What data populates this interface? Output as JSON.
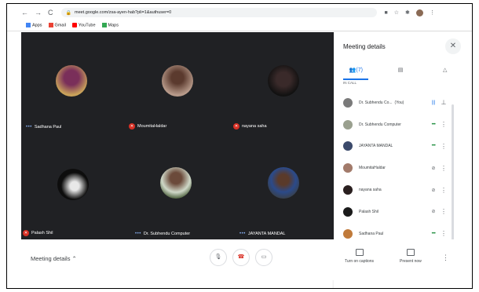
{
  "browser": {
    "url": "meet.google.com/zsa-ayen-hab?pli=1&authuser=0",
    "bookmarks": [
      {
        "label": "Apps",
        "color": "#4285f4"
      },
      {
        "label": "Gmail",
        "color": "#ea4335"
      },
      {
        "label": "YouTube",
        "color": "#ff0000"
      },
      {
        "label": "Maps",
        "color": "#34a853"
      }
    ]
  },
  "tiles": [
    {
      "name": "Sadhana Paul",
      "status": "speaking",
      "bg": "#c9a25a",
      "fg": "#7a2f5a"
    },
    {
      "name": "MoumitaHaldar",
      "status": "muted",
      "bg": "#b79a8a",
      "fg": "#5b3a2e"
    },
    {
      "name": "nayana saha",
      "status": "muted",
      "bg": "#111111",
      "fg": "#3a2a2a"
    },
    {
      "name": "Palash Shil",
      "status": "muted",
      "bg": "#0d0d0d",
      "fg": "#e8e8e8"
    },
    {
      "name": "Dr. Subhendu Computer",
      "status": "speaking",
      "bg": "#cfd8c8",
      "fg": "#4a5e3a"
    },
    {
      "name": "JAYANTA MANDAL",
      "status": "speaking",
      "bg": "#3a3f44",
      "fg": "#2b4a8a"
    }
  ],
  "panel": {
    "title": "Meeting details",
    "people_tab_count": "(7)",
    "section_label": "IN CALL",
    "participants": [
      {
        "name": "Dr. Subhendu Co...",
        "you_label": "(You)",
        "color": "#7a7a7a",
        "indicator": "speaking-blue",
        "action": "pin"
      },
      {
        "name": "Dr. Subhendu Computer",
        "you_label": "",
        "color": "#9aa08f",
        "indicator": "speaking",
        "action": "more"
      },
      {
        "name": "JAYANTA MANDAL",
        "you_label": "",
        "color": "#3b4a6b",
        "indicator": "speaking",
        "action": "more"
      },
      {
        "name": "MoumitaHaldar",
        "you_label": "",
        "color": "#a27a6a",
        "indicator": "muted",
        "action": "more"
      },
      {
        "name": "nayana saha",
        "you_label": "",
        "color": "#2a1f1f",
        "indicator": "muted",
        "action": "more"
      },
      {
        "name": "Palash Shil",
        "you_label": "",
        "color": "#1a1a1a",
        "indicator": "muted",
        "action": "more"
      },
      {
        "name": "Sadhana Paul",
        "you_label": "",
        "color": "#c07a3a",
        "indicator": "speaking",
        "action": "more"
      }
    ]
  },
  "bottom": {
    "meeting_details_label": "Meeting details",
    "captions_label": "Turn on captions",
    "present_label": "Present now"
  }
}
